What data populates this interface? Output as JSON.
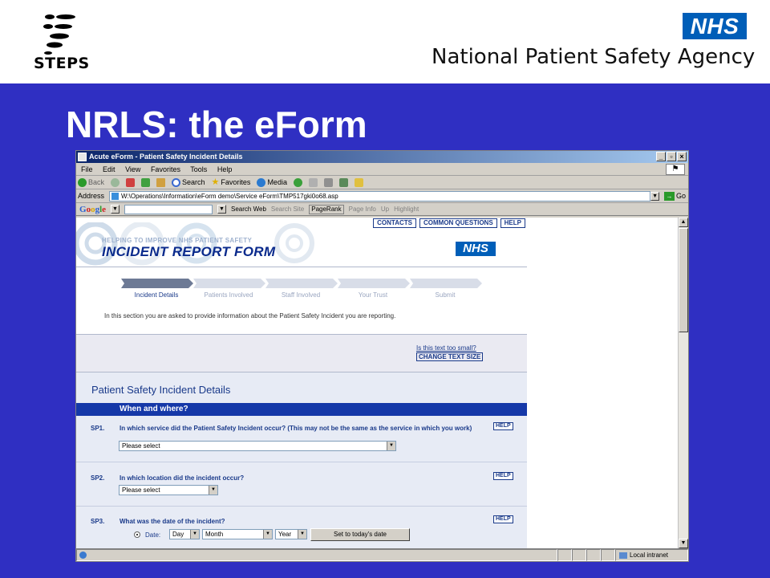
{
  "slide": {
    "steps_logo_text": "STEPS",
    "nhs_logo_text": "NHS",
    "agency_name": "National Patient Safety Agency",
    "title": "NRLS: the eForm"
  },
  "browser": {
    "window_title": "Acute eForm - Patient Safety Incident Details",
    "window_buttons": [
      "_",
      "▫",
      "×"
    ],
    "menu": [
      "File",
      "Edit",
      "View",
      "Favorites",
      "Tools",
      "Help"
    ],
    "toolbar": {
      "back": "Back",
      "search": "Search",
      "favorites": "Favorites",
      "media": "Media"
    },
    "address_label": "Address",
    "address_value": "W:\\Operations\\Information\\eForm demo\\Service eForm\\TMP517gki0o68.asp",
    "go_label": "Go",
    "google": {
      "logo": [
        "G",
        "o",
        "o",
        "g",
        "l",
        "e"
      ],
      "search_web": "Search Web",
      "search_site": "Search Site",
      "pagerank": "PageRank",
      "page_info": "Page Info",
      "up": "Up",
      "highlight": "Highlight"
    },
    "status": {
      "zone": "Local intranet"
    }
  },
  "form": {
    "top_links": [
      "CONTACTS",
      "COMMON QUESTIONS",
      "HELP"
    ],
    "banner_tagline": "HELPING TO IMPROVE NHS PATIENT SAFETY",
    "banner_title": "INCIDENT REPORT FORM",
    "banner_nhs": "NHS",
    "steps": [
      {
        "label": "Incident Details",
        "active": true
      },
      {
        "label": "Patients Involved",
        "active": false
      },
      {
        "label": "Staff Involved",
        "active": false
      },
      {
        "label": "Your Trust",
        "active": false
      },
      {
        "label": "Submit",
        "active": false
      }
    ],
    "intro": "In this section you are asked to provide information about the Patient Safety Incident you are reporting.",
    "text_size_question": "Is this text too small?",
    "change_text_size": "CHANGE TEXT SIZE",
    "details_title": "Patient Safety Incident Details",
    "section_title": "When and where?",
    "help_label": "HELP",
    "questions": [
      {
        "code": "SP1.",
        "text": "In which service did the Patient Safety Incident occur? (This may not be the same as the service in which you work)",
        "select": "Please select"
      },
      {
        "code": "SP2.",
        "text": "In which location did the incident occur?",
        "select": "Please select"
      },
      {
        "code": "SP3.",
        "text": "What was the date of the incident?"
      }
    ],
    "date": {
      "label": "Date:",
      "day": "Day",
      "month": "Month",
      "year": "Year",
      "today_button": "Set to today's date"
    }
  },
  "colors": {
    "slide_background": "#2f2fc2",
    "nhs_blue": "#005eb8",
    "form_navy": "#1a3a8a",
    "section_bar": "#1538a8"
  }
}
